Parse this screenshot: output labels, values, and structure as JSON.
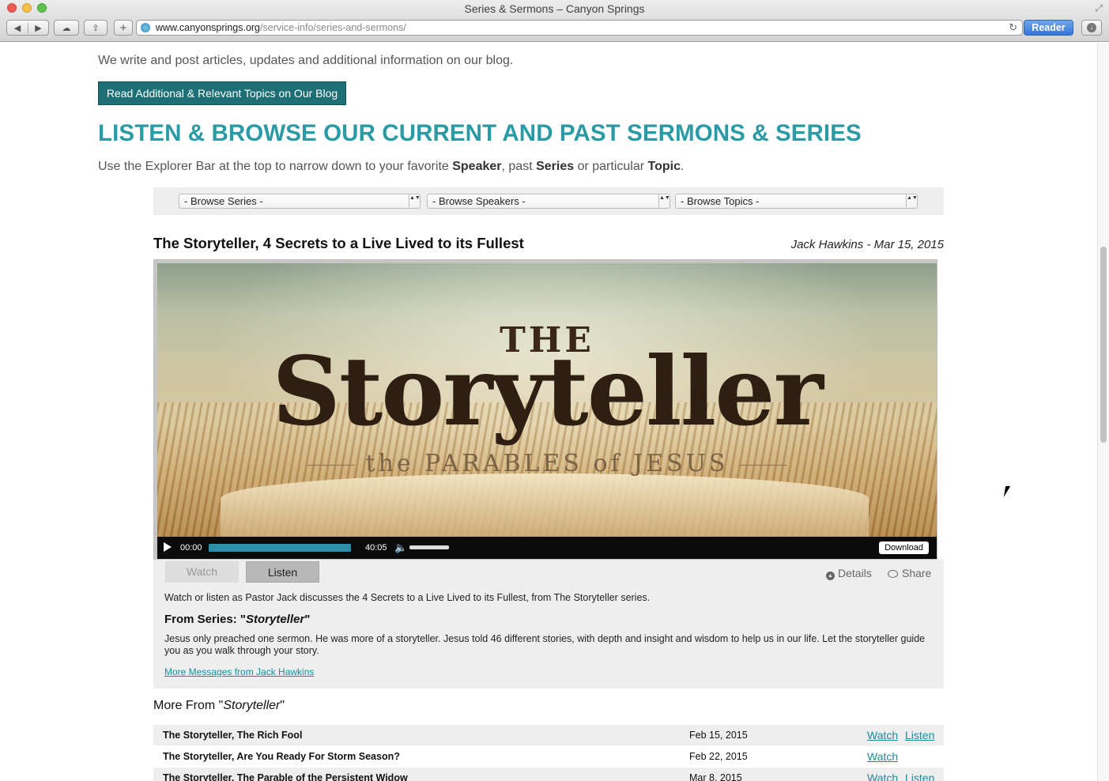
{
  "browser": {
    "window_title": "Series & Sermons – Canyon Springs",
    "url_host": "www.canyonsprings.org",
    "url_path": "/service-info/series-and-sermons/",
    "reader_label": "Reader",
    "back_glyph": "◀",
    "forward_glyph": "▶",
    "newtab_glyph": "+",
    "reload_glyph": "↻",
    "share_glyph": "⇪",
    "icloud_glyph": "☁",
    "fullscreen_glyph": "⤢",
    "download_glyph": "↓"
  },
  "page": {
    "intro_text": "We write and post articles, updates and additional information on our blog.",
    "blog_button": "Read Additional & Relevant Topics on Our Blog",
    "heading": "LISTEN & BROWSE OUR CURRENT AND PAST SERMONS & SERIES",
    "explorer_note": {
      "before": "Use the Explorer Bar at the top to narrow down to your favorite ",
      "speaker": "Speaker",
      "mid1": ", past ",
      "series": "Series",
      "mid2": " or particular ",
      "topic": "Topic",
      "end": "."
    },
    "browse": {
      "series": "- Browse Series -",
      "speakers": "- Browse Speakers -",
      "topics": "- Browse Topics -",
      "arrows": "▲▼"
    }
  },
  "sermon": {
    "title": "The Storyteller, 4 Secrets to a Live Lived to its Fullest",
    "meta": "Jack Hawkins - Mar 15, 2015",
    "artwork": {
      "the": "THE",
      "main": "Storyteller",
      "sub": "the PARABLES of JESUS"
    },
    "player": {
      "current_time": "00:00",
      "duration": "40:05",
      "download_label": "Download",
      "play_icon": "play-icon",
      "volume_icon": "speaker-icon",
      "speaker_glyph": "🔈"
    },
    "tabs": {
      "watch": "Watch",
      "listen": "Listen"
    },
    "actions": {
      "details": "Details",
      "share": "Share"
    },
    "description": "Watch or listen as Pastor Jack discusses the 4 Secrets to a Live Lived to its Fullest, from The Storyteller series.",
    "from_series_prefix": "From Series: \"",
    "from_series_name": "Storyteller",
    "from_series_suffix": "\"",
    "series_description": "Jesus only preached one sermon. He was more of a storyteller. Jesus told 46 different stories, with depth and insight and wisdom to help us in our life. Let the storyteller guide you as you walk through your story.",
    "more_messages_link": "More Messages from Jack Hawkins"
  },
  "more_from": {
    "prefix": "More From \"",
    "series": "Storyteller",
    "suffix": "\"",
    "rows": [
      {
        "title": "The Storyteller, The Rich Fool",
        "date": "Feb 15, 2015",
        "watch": "Watch",
        "listen": "Listen"
      },
      {
        "title": "The Storyteller, Are You Ready For Storm Season?",
        "date": "Feb 22, 2015",
        "watch": "Watch",
        "listen": ""
      },
      {
        "title": "The Storyteller, The Parable of the Persistent Widow",
        "date": "Mar 8, 2015",
        "watch": "Watch",
        "listen": "Listen"
      }
    ]
  },
  "colors": {
    "accent_teal": "#2a9aa5",
    "button_teal": "#1d6f76",
    "link": "#1d8aa0"
  }
}
